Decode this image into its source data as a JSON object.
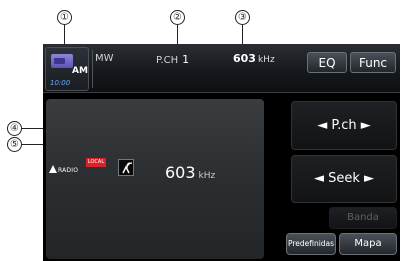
{
  "callouts": [
    "①",
    "②",
    "③",
    "④",
    "⑤"
  ],
  "status": {
    "source": "AM",
    "clock": "10:00",
    "band": "MW",
    "pch_label": "P.CH",
    "pch_value": "1",
    "freq_value": "603",
    "freq_unit": "kHz"
  },
  "top_buttons": {
    "eq": "EQ",
    "func": "Func"
  },
  "panel": {
    "logo": "RADIO",
    "badge": "LOCAL",
    "freq_value": "603",
    "freq_unit": "kHz"
  },
  "right_buttons": {
    "pch": "◄  P.ch  ►",
    "seek": "◄  Seek  ►",
    "banda": "Banda",
    "predefinidas": "Predefinidas",
    "mapa": "Mapa"
  }
}
